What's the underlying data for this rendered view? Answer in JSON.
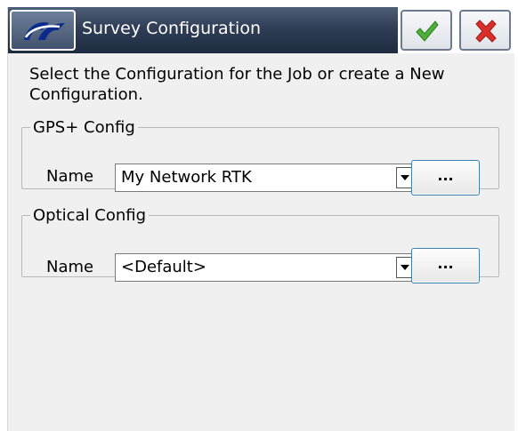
{
  "window": {
    "title": "Survey Configuration",
    "icons": {
      "logo": "topcon-logo-icon",
      "ok": "checkmark-icon",
      "cancel": "close-icon"
    },
    "colors": {
      "title_bar": "#2f3e56",
      "ok_green": "#4caf3a",
      "cancel_red": "#d9302b"
    }
  },
  "instruction": "Select the Configuration for the Job or create a New Configuration.",
  "gps_config": {
    "legend": "GPS+ Config",
    "name_label": "Name",
    "selected": "My Network RTK",
    "more_label": "..."
  },
  "optical_config": {
    "legend": "Optical Config",
    "name_label": "Name",
    "selected": "<Default>",
    "more_label": "..."
  }
}
